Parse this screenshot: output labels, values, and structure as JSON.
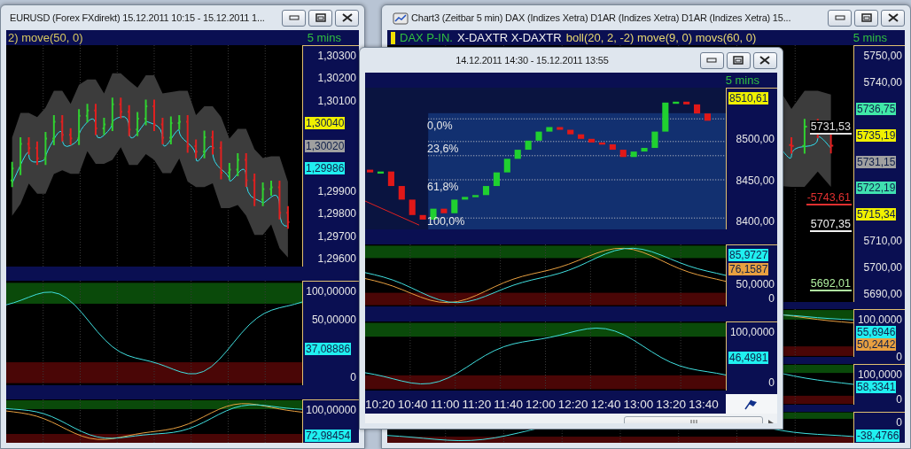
{
  "windows": [
    {
      "title": "EURUSD (Forex FXdirekt) 15.12.2011 10:15 - 15.12.2011 1...",
      "icon": false,
      "header": [
        {
          "text": "2) move(50, 0)",
          "color": "#d8c860"
        }
      ],
      "interval": "5 mins",
      "panels": [
        {
          "kind": "price",
          "axis": [
            {
              "kind": "tick",
              "text": "1,30300"
            },
            {
              "kind": "tick",
              "text": "1,30200"
            },
            {
              "kind": "tick",
              "text": "1,30100"
            },
            {
              "kind": "badge",
              "text": "1,30040",
              "color": "#f0f000"
            },
            {
              "kind": "badge",
              "text": "1,30020",
              "color": "#a0a0a0"
            },
            {
              "kind": "badge",
              "text": "1,29986",
              "color": "#20f0f0"
            },
            {
              "kind": "tick",
              "text": "1,29900"
            },
            {
              "kind": "tick",
              "text": "1,29800"
            },
            {
              "kind": "tick",
              "text": "1,29700"
            },
            {
              "kind": "tick",
              "text": "1,29600"
            }
          ]
        },
        {
          "kind": "oscillator",
          "axis": [
            {
              "kind": "tick",
              "text": "100,00000"
            },
            {
              "kind": "tick",
              "text": "50,00000"
            },
            {
              "kind": "badge",
              "text": "37,08886",
              "color": "#20f0f0"
            },
            {
              "kind": "tick",
              "text": "0"
            }
          ]
        },
        {
          "kind": "oscillator",
          "axis": [
            {
              "kind": "tick",
              "text": "100,00000"
            },
            {
              "kind": "badge",
              "text": "72,98454",
              "color": "#20f0f0"
            }
          ]
        }
      ]
    },
    {
      "title": "Chart3 (Zeitbar 5 min)  DAX (Indizes Xetra) D1AR (Indizes Xetra) D1AR (Indizes Xetra) 15...",
      "icon": true,
      "header": [
        {
          "text": "DAX P-IN.",
          "color": "#30c040"
        },
        {
          "text": "X-DAXTR X-DAXTR",
          "color": "#f0f0f0"
        },
        {
          "text": "boll(20, 2, -2) move(9, 0) movs(60, 0)",
          "color": "#e8d870"
        }
      ],
      "interval": "5 mins",
      "chart_labels": [
        {
          "text": "5731,53",
          "color": "#e0e0e0"
        },
        {
          "text": "-5743,61",
          "color": "#e03030"
        },
        {
          "text": "5707,35",
          "color": "#f0f0f0"
        },
        {
          "text": "5692,01",
          "color": "#b0f0a0"
        }
      ],
      "panels": [
        {
          "kind": "price",
          "axis": [
            {
              "kind": "tick",
              "text": "5750,00"
            },
            {
              "kind": "tick",
              "text": "5740,00"
            },
            {
              "kind": "badge",
              "text": "5736,75",
              "color": "#40e8a8"
            },
            {
              "kind": "badge",
              "text": "5735,19",
              "color": "#f0f000"
            },
            {
              "kind": "badge",
              "text": "5731,15",
              "color": "#a0a0a0"
            },
            {
              "kind": "badge",
              "text": "5722,19",
              "color": "#40e0b0"
            },
            {
              "kind": "badge",
              "text": "5715,34",
              "color": "#f0f000"
            },
            {
              "kind": "tick",
              "text": "5710,00"
            },
            {
              "kind": "tick",
              "text": "5700,00"
            },
            {
              "kind": "tick",
              "text": "5690,00"
            }
          ]
        },
        {
          "kind": "oscillator",
          "axis": [
            {
              "kind": "tick",
              "text": "100,0000"
            },
            {
              "kind": "badge",
              "text": "55,6946",
              "color": "#20f0f0"
            },
            {
              "kind": "badge",
              "text": "50,2442",
              "color": "#e8a040"
            },
            {
              "kind": "tick",
              "text": "0"
            }
          ]
        },
        {
          "kind": "oscillator",
          "axis": [
            {
              "kind": "tick",
              "text": "100,0000"
            },
            {
              "kind": "badge",
              "text": "58,3341",
              "color": "#20f0f0"
            },
            {
              "kind": "tick",
              "text": "0"
            }
          ]
        },
        {
          "kind": "oscillator",
          "axis": [
            {
              "kind": "tick",
              "text": "0"
            },
            {
              "kind": "badge",
              "text": "-38,4766",
              "color": "#20f0f0"
            }
          ]
        }
      ]
    },
    {
      "title": "14.12.2011 14:30 - 15.12.2011 13:55",
      "icon": false,
      "interval": "5 mins",
      "fib_levels": [
        "0,0%",
        "23,6%",
        "61,8%",
        "100,0%"
      ],
      "panels": [
        {
          "kind": "fibonacci",
          "axis": [
            {
              "kind": "badge",
              "text": "8510,61",
              "color": "#f0f000"
            },
            {
              "kind": "tick",
              "text": "8500,00"
            },
            {
              "kind": "tick",
              "text": "8450,00"
            },
            {
              "kind": "tick",
              "text": "8400,00"
            }
          ]
        },
        {
          "kind": "oscillator",
          "axis": [
            {
              "kind": "badge",
              "text": "85,9727",
              "color": "#20f0f0"
            },
            {
              "kind": "badge",
              "text": "76,1587",
              "color": "#e8a040"
            },
            {
              "kind": "tick",
              "text": "50,0000"
            },
            {
              "kind": "tick",
              "text": "0"
            }
          ]
        },
        {
          "kind": "oscillator",
          "axis": [
            {
              "kind": "tick",
              "text": "100,0000"
            },
            {
              "kind": "badge",
              "text": "46,4981",
              "color": "#20f0f0"
            },
            {
              "kind": "tick",
              "text": "0"
            }
          ]
        }
      ],
      "time_axis": [
        "10:20",
        "10:40",
        "11:00",
        "11:20",
        "11:40",
        "12:00",
        "12:20",
        "12:40",
        "13:00",
        "13:20",
        "13:40"
      ]
    }
  ]
}
